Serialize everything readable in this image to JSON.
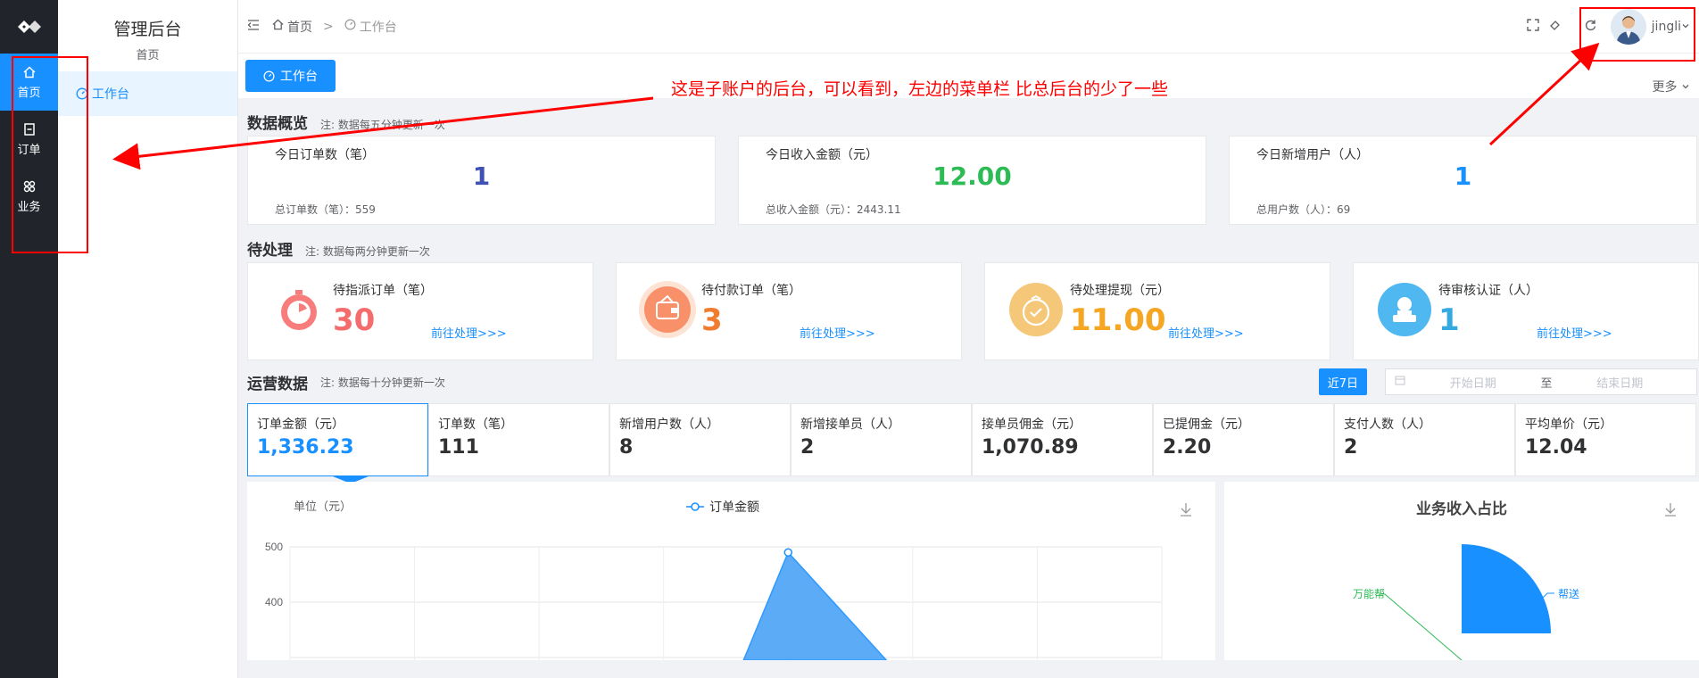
{
  "sidebar": {
    "items": [
      {
        "label": "首页",
        "icon": "home-icon",
        "active": true
      },
      {
        "label": "订单",
        "icon": "order-icon",
        "active": false
      },
      {
        "label": "业务",
        "icon": "business-icon",
        "active": false
      }
    ]
  },
  "submenu": {
    "title": "管理后台",
    "subtitle": "首页",
    "items": [
      {
        "label": "工作台",
        "icon": "dashboard-icon"
      }
    ]
  },
  "header": {
    "breadcrumb": [
      "首页",
      "工作台"
    ],
    "separator": ">",
    "username": "jingli"
  },
  "tabs": {
    "active_label": "工作台",
    "more_label": "更多"
  },
  "annotation": {
    "text": "这是子账户的后台，可以看到，左边的菜单栏 比总后台的少了一些",
    "color": "#ff0000"
  },
  "overview": {
    "title": "数据概览",
    "note": "注: 数据每五分钟更新一次",
    "cards": [
      {
        "label": "今日订单数（笔）",
        "value": "1",
        "total": "总订单数（笔）：559",
        "color": "#3f51b5"
      },
      {
        "label": "今日收入金额（元）",
        "value": "12.00",
        "total": "总收入金额（元）：2443.11",
        "color": "#2dbb55"
      },
      {
        "label": "今日新增用户（人）",
        "value": "1",
        "total": "总用户数（人）：69",
        "color": "#1890ff"
      }
    ]
  },
  "pending": {
    "title": "待处理",
    "note": "注: 数据每两分钟更新一次",
    "cards": [
      {
        "label": "待指派订单（笔）",
        "value": "30",
        "link": "前往处理>>>",
        "color": "#f56c6c",
        "icon": "stopwatch-icon"
      },
      {
        "label": "待付款订单（笔）",
        "value": "3",
        "link": "前往处理>>>",
        "color": "#f07c30",
        "icon": "wallet-icon"
      },
      {
        "label": "待处理提现（元）",
        "value": "11.00",
        "link": "前往处理>>>",
        "color": "#f5a623",
        "icon": "withdraw-icon"
      },
      {
        "label": "待审核认证（人）",
        "value": "1",
        "link": "前往处理>>>",
        "color": "#36a9e1",
        "icon": "verify-user-icon"
      }
    ]
  },
  "operations": {
    "title": "运营数据",
    "note": "注: 数据每十分钟更新一次",
    "range_button": "近7日",
    "start_placeholder": "开始日期",
    "range_sep": "至",
    "end_placeholder": "结束日期",
    "metrics": [
      {
        "label": "订单金额（元）",
        "value": "1,336.23",
        "active": true
      },
      {
        "label": "订单数（笔）",
        "value": "111"
      },
      {
        "label": "新增用户数（人）",
        "value": "8"
      },
      {
        "label": "新增接单员（人）",
        "value": "2"
      },
      {
        "label": "接单员佣金（元）",
        "value": "1,070.89"
      },
      {
        "label": "已提佣金（元）",
        "value": "2.20"
      },
      {
        "label": "支付人数（人）",
        "value": "2"
      },
      {
        "label": "平均单价（元）",
        "value": "12.04"
      }
    ]
  },
  "chart_data": [
    {
      "type": "area",
      "ylabel": "单位（元）",
      "legend": "订单金额",
      "yticks": [
        "500",
        "400"
      ],
      "ylim": [
        300,
        500
      ],
      "peak_value": 490,
      "color": "#1890ff"
    },
    {
      "type": "pie",
      "title": "业务收入占比",
      "labels": [
        "万能帮",
        "帮送"
      ],
      "color": "#1890ff"
    }
  ]
}
